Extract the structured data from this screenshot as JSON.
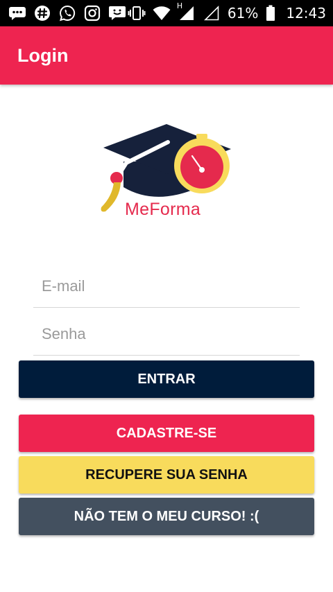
{
  "status_bar": {
    "icons": [
      "messages-icon",
      "slack-icon",
      "whatsapp-icon",
      "instagram-icon",
      "chat-icon",
      "vibrate-icon",
      "wifi-icon",
      "signal-h-icon",
      "signal-empty-icon",
      "battery-icon"
    ],
    "signal_label": "H",
    "battery": "61%",
    "time": "12:43"
  },
  "app_bar": {
    "title": "Login",
    "color": "#ee2450"
  },
  "logo": {
    "text": "MeForma"
  },
  "form": {
    "email_placeholder": "E-mail",
    "password_placeholder": "Senha"
  },
  "buttons": {
    "entrar": "ENTRAR",
    "cadastre": "CADASTRE-SE",
    "recupere": "RECUPERE SUA SENHA",
    "sem_curso": "NÃO TEM O MEU CURSO! :("
  },
  "colors": {
    "primary": "#ee2450",
    "navy": "#001c3b",
    "yellow": "#f8db5c",
    "slate": "#43505f"
  }
}
